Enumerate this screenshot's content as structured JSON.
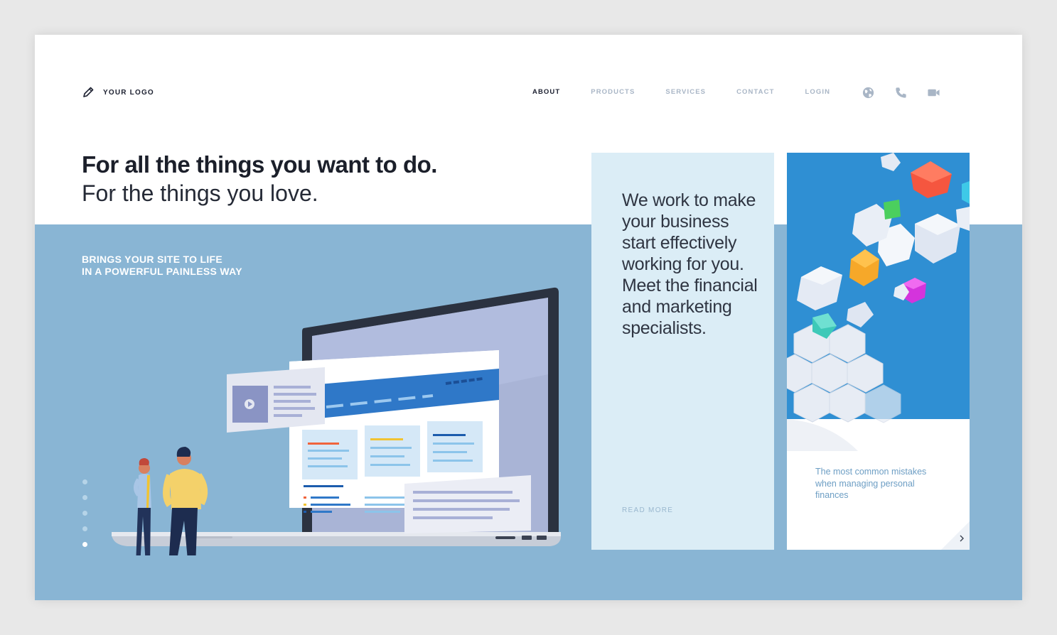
{
  "header": {
    "logo_text": "YOUR LOGO",
    "logo_icon": "pencil-icon",
    "nav": [
      {
        "label": "ABOUT",
        "active": true
      },
      {
        "label": "PRODUCTS",
        "active": false
      },
      {
        "label": "SERVICES",
        "active": false
      },
      {
        "label": "CONTACT",
        "active": false
      },
      {
        "label": "LOGIN",
        "active": false
      }
    ],
    "icons": [
      "globe-icon",
      "phone-icon",
      "video-camera-icon"
    ]
  },
  "hero": {
    "title": "For all the things you want to do.",
    "subtitle": "For the things you love.",
    "tagline_line1": "BRINGS YOUR SITE TO LIFE",
    "tagline_line2": "IN A POWERFUL PAINLESS WAY",
    "slider": {
      "count": 5,
      "active_index": 4
    }
  },
  "card1": {
    "text": "We work to make your business start effectively working for you. Meet the financial and marketing specialists.",
    "link": "READ MORE"
  },
  "card2": {
    "text": "The most common mistakes when managing personal finances",
    "arrow_icon": "chevron-right-icon"
  },
  "colors": {
    "band": "#89b5d4",
    "card1_bg": "#dbedf6",
    "card2_art": "#2f8fd3",
    "heading": "#1b1f2a",
    "nav_inactive": "#a9b6c6"
  }
}
